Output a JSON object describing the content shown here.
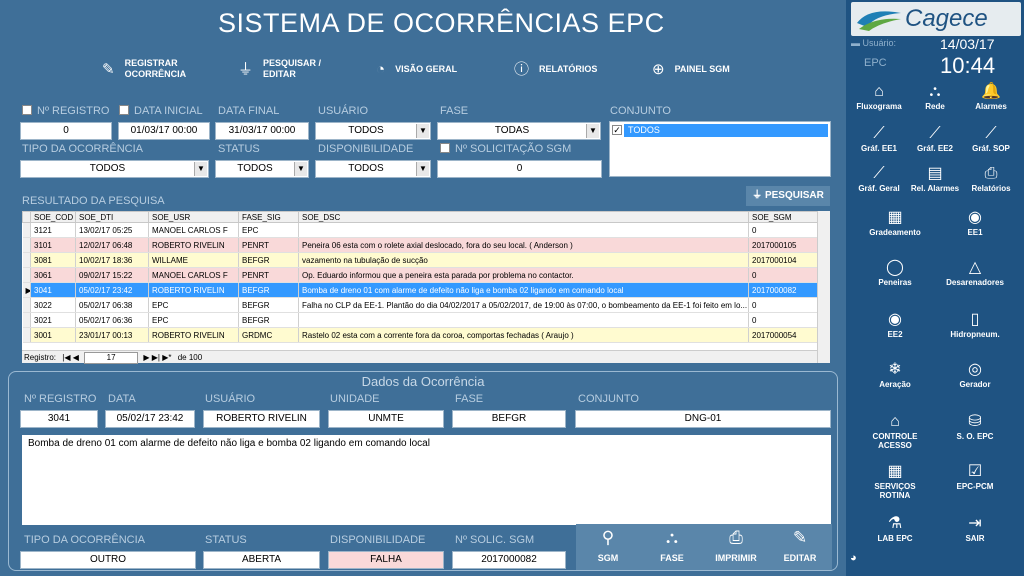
{
  "app": {
    "title": "SISTEMA DE OCORRÊNCIAS EPC",
    "logo": "Cagece"
  },
  "menu": [
    {
      "label": "REGISTRAR\nOCORRÊNCIA",
      "icon": "pencil-icon"
    },
    {
      "label": "PESQUISAR /\nEDITAR",
      "icon": "filter-edit-icon"
    },
    {
      "label": "VISÃO GERAL",
      "icon": "gauge-icon"
    },
    {
      "label": "RELATÓRIOS",
      "icon": "info-icon"
    },
    {
      "label": "PAINEL SGM",
      "icon": "globe-icon"
    }
  ],
  "filters": {
    "nregistro_label": "Nº REGISTRO",
    "nregistro": "0",
    "data_inicial_label": "DATA INICIAL",
    "data_inicial": "01/03/17 00:00",
    "data_final_label": "DATA FINAL",
    "data_final": "31/03/17 00:00",
    "usuario_label": "USUÁRIO",
    "usuario": "TODOS",
    "fase_label": "FASE",
    "fase": "TODAS",
    "conjunto_label": "CONJUNTO",
    "conjunto": "TODOS",
    "tipo_label": "TIPO DA OCORRÊNCIA",
    "tipo": "TODOS",
    "status_label": "STATUS",
    "status": "TODOS",
    "disp_label": "DISPONIBILIDADE",
    "disp": "TODOS",
    "nsgm_label": "Nº SOLICITAÇÃO SGM",
    "nsgm": "0"
  },
  "results": {
    "title": "RESULTADO DA PESQUISA",
    "search_button": "PESQUISAR",
    "columns": [
      "SOE_COD",
      "SOE_DTI",
      "SOE_USR",
      "FASE_SIG",
      "SOE_DSC",
      "SOE_SGM"
    ],
    "rows": [
      {
        "cells": [
          "3121",
          "13/02/17 05:25",
          "MANOEL CARLOS F",
          "EPC",
          "",
          "0"
        ],
        "color": "#ffffff"
      },
      {
        "cells": [
          "3101",
          "12/02/17 06:48",
          "ROBERTO RIVELIN",
          "PENRT",
          "Peneira 06 esta com o rolete axial deslocado, fora do seu local. ( Anderson )",
          "2017000105"
        ],
        "color": "#f9d9d9"
      },
      {
        "cells": [
          "3081",
          "10/02/17 18:36",
          "WILLAME",
          "BEFGR",
          "vazamento na tubulação de sucção",
          "2017000104"
        ],
        "color": "#fffbd0"
      },
      {
        "cells": [
          "3061",
          "09/02/17 15:22",
          "MANOEL CARLOS F",
          "PENRT",
          "Op. Eduardo informou que a peneira esta parada por problema no contactor.",
          "0"
        ],
        "color": "#f9d9d9"
      },
      {
        "cells": [
          "3041",
          "05/02/17 23:42",
          "ROBERTO RIVELIN",
          "BEFGR",
          "Bomba de dreno 01 com alarme de defeito não liga e bomba 02 ligando em comando local",
          "2017000082"
        ],
        "color": "#3399ff",
        "selected": true
      },
      {
        "cells": [
          "3022",
          "05/02/17 06:38",
          "EPC",
          "BEFGR",
          "Falha no CLP da EE-1. Plantão do dia 04/02/2017 a 05/02/2017, de 19:00 às 07:00, o bombeamento da EE-1 foi feito em lo...",
          "0"
        ],
        "color": "#ffffff"
      },
      {
        "cells": [
          "3021",
          "05/02/17 06:36",
          "EPC",
          "BEFGR",
          "",
          "0"
        ],
        "color": "#ffffff"
      },
      {
        "cells": [
          "3001",
          "23/01/17 00:13",
          "ROBERTO RIVELIN",
          "GRDMC",
          "Rastelo 02 esta com a corrente fora da coroa, comportas fechadas ( Araujo )",
          "2017000054"
        ],
        "color": "#fffbd0"
      }
    ],
    "nav_label": "Registro:",
    "nav_current": "17",
    "nav_total": "de 100"
  },
  "detail": {
    "title": "Dados da Ocorrência",
    "nregistro_label": "Nº REGISTRO",
    "nregistro": "3041",
    "data_label": "DATA",
    "data": "05/02/17 23:42",
    "usuario_label": "USUÁRIO",
    "usuario": "ROBERTO RIVELIN",
    "unidade_label": "UNIDADE",
    "unidade": "UNMTE",
    "fase_label": "FASE",
    "fase": "BEFGR",
    "conjunto_label": "CONJUNTO",
    "conjunto": "DNG-01",
    "descricao": "Bomba de dreno 01 com alarme de defeito não liga e bomba 02 ligando em comando local",
    "tipo_label": "TIPO DA OCORRÊNCIA",
    "tipo": "OUTRO",
    "status_label": "STATUS",
    "status": "ABERTA",
    "disp_label": "DISPONIBILIDADE",
    "disp": "FALHA",
    "nsolic_label": "Nº SOLIC. SGM",
    "nsolic": "2017000082"
  },
  "actions": [
    {
      "label": "SGM",
      "icon": "magnifier-icon"
    },
    {
      "label": "FASE",
      "icon": "network-icon"
    },
    {
      "label": "IMPRIMIR",
      "icon": "printer-icon"
    },
    {
      "label": "EDITAR",
      "icon": "pencil-icon"
    }
  ],
  "sidebar": {
    "usuario_label": "Usuário:",
    "unit": "EPC",
    "date": "14/03/17",
    "time": "10:44",
    "items": [
      {
        "label": "Fluxograma",
        "icon": "home-icon"
      },
      {
        "label": "Rede",
        "icon": "network-icon"
      },
      {
        "label": "Alarmes",
        "icon": "bell-icon"
      },
      {
        "label": "Gráf. EE1",
        "icon": "chart-line-icon"
      },
      {
        "label": "Gráf. EE2",
        "icon": "chart-line-icon"
      },
      {
        "label": "Gráf. SOP",
        "icon": "chart-line-icon"
      },
      {
        "label": "Gráf. Geral",
        "icon": "chart-line-icon"
      },
      {
        "label": "Rel. Alarmes",
        "icon": "document-icon"
      },
      {
        "label": "Relatórios",
        "icon": "printer-icon"
      },
      {
        "label": "Gradeamento",
        "icon": "grid-icon"
      },
      {
        "label": "EE1",
        "icon": "pump-icon"
      },
      {
        "label": "Peneiras",
        "icon": "circle-icon"
      },
      {
        "label": "Desarenadores",
        "icon": "triangle-icon"
      },
      {
        "label": "EE2",
        "icon": "pump-icon"
      },
      {
        "label": "Hidropneum.",
        "icon": "tank-icon"
      },
      {
        "label": "Aeração",
        "icon": "snowflake-icon"
      },
      {
        "label": "Gerador",
        "icon": "generator-icon"
      },
      {
        "label": "CONTROLE\nACESSO",
        "icon": "home-icon"
      },
      {
        "label": "S. O. EPC",
        "icon": "database-icon"
      },
      {
        "label": "SERVIÇOS\nROTINA",
        "icon": "calendar-icon"
      },
      {
        "label": "EPC-PCM",
        "icon": "checkbox-icon"
      },
      {
        "label": "LAB EPC",
        "icon": "flask-icon"
      },
      {
        "label": "SAIR",
        "icon": "exit-icon"
      }
    ]
  }
}
